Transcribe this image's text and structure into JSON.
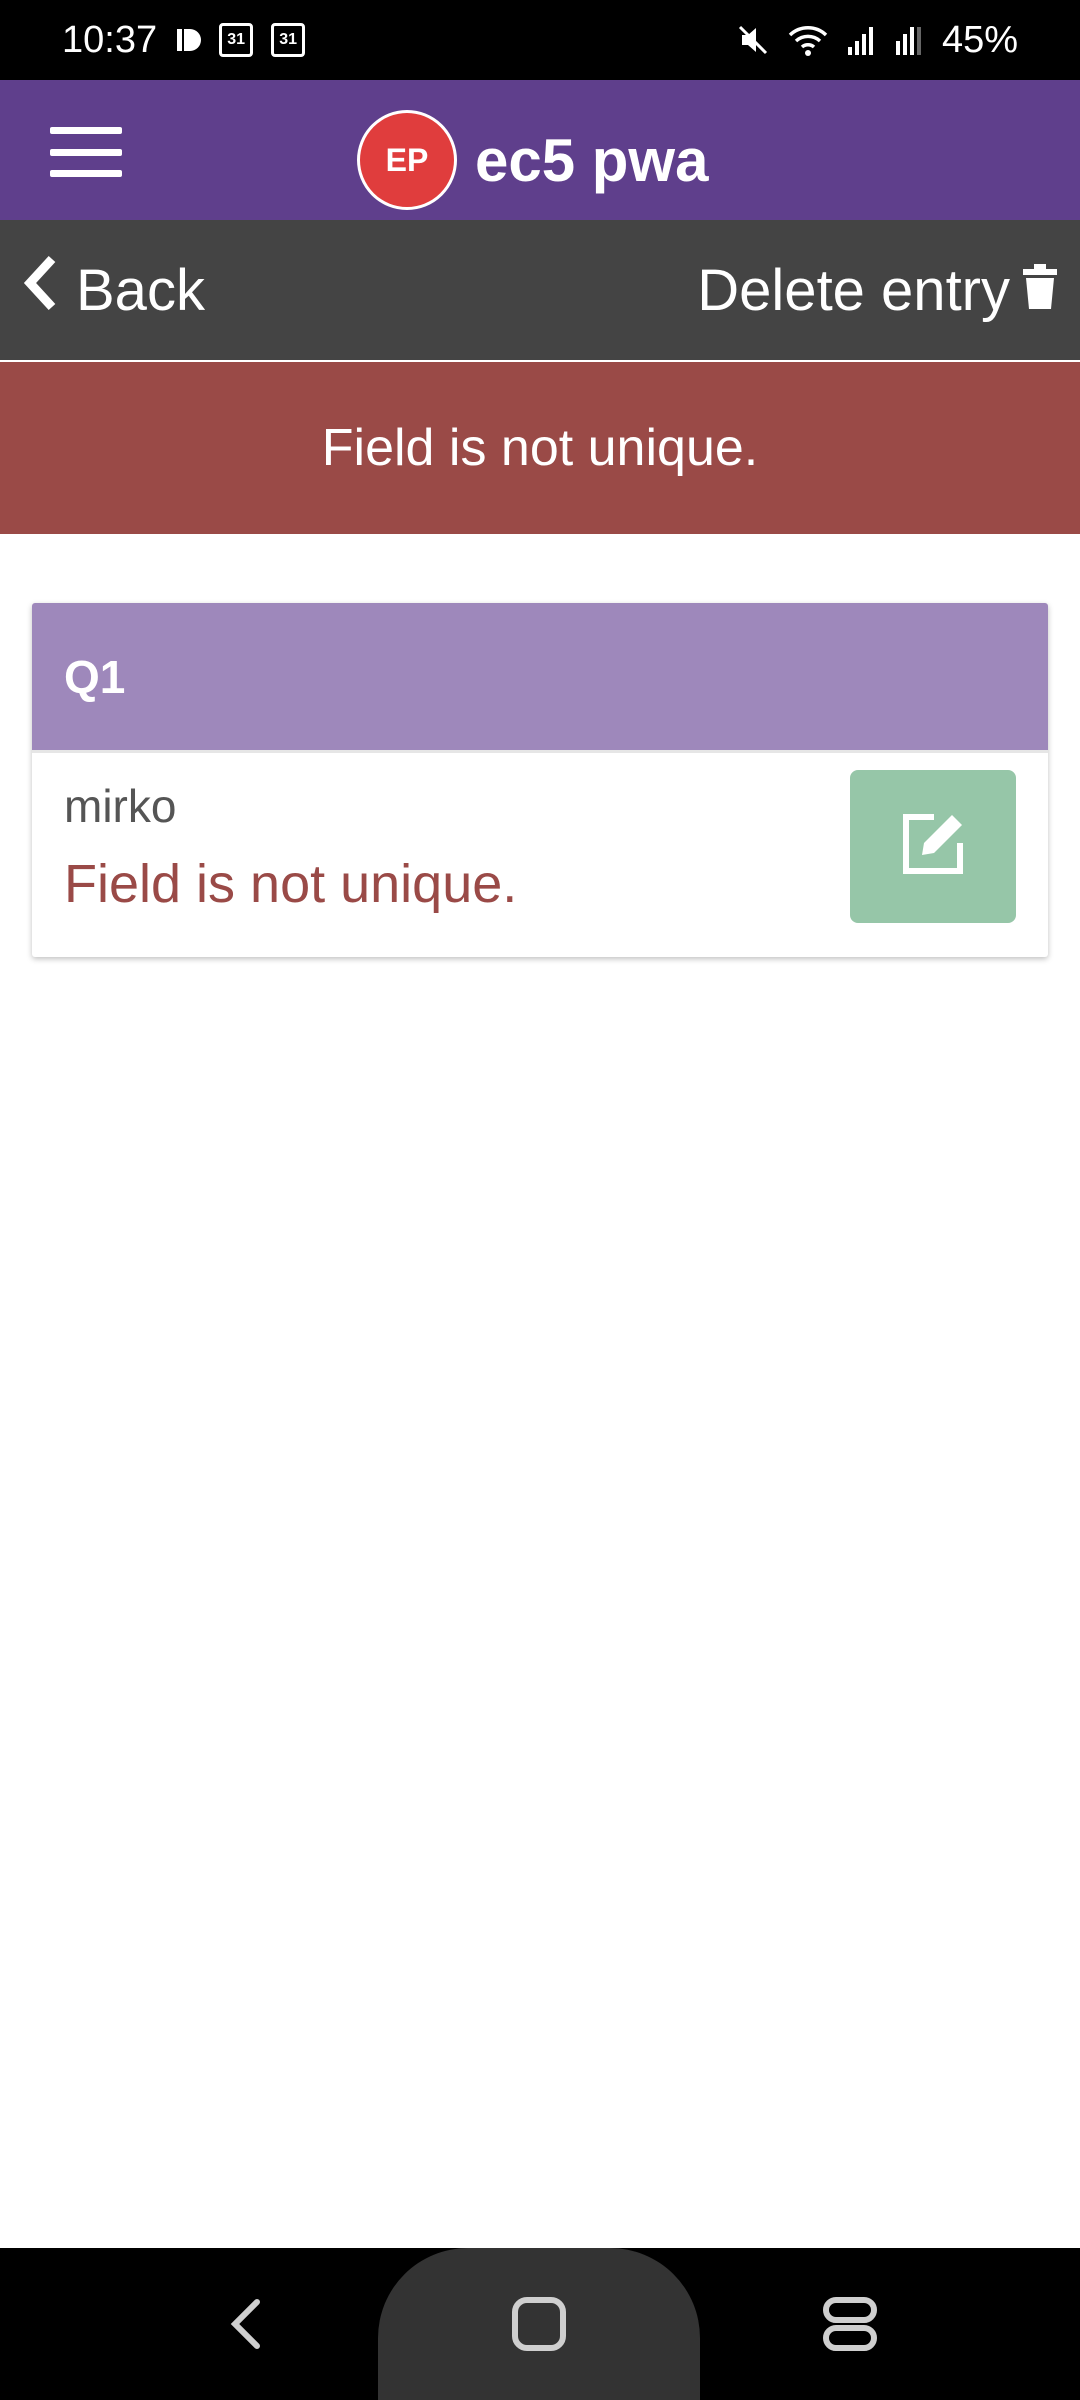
{
  "status_bar": {
    "time": "10:37",
    "battery_percent": "45%",
    "calendar_day_1": "31",
    "calendar_day_2": "31",
    "icons": [
      "app-d-icon",
      "calendar-icon",
      "calendar-icon",
      "mute-icon",
      "wifi-icon",
      "signal-icon",
      "signal-r-icon"
    ]
  },
  "header": {
    "logo_text": "EP",
    "title": "ec5 pwa",
    "menu_icon": "hamburger-menu-icon",
    "logo_color": "#e03d3d",
    "background": "#5f3f8c"
  },
  "nav": {
    "back_label": "Back",
    "back_icon": "chevron-left-icon",
    "delete_label": "Delete entry",
    "delete_icon": "trash-icon"
  },
  "error_banner": {
    "message": "Field is not unique.",
    "color": "#9a4a47"
  },
  "question_card": {
    "question": "Q1",
    "answer": "mirko",
    "error": "Field is not unique.",
    "edit_icon": "edit-icon",
    "header_color": "#9e88bb",
    "edit_color": "#96c6a8"
  },
  "system_nav": {
    "icons": [
      "back-icon",
      "home-icon",
      "recents-icon"
    ]
  }
}
